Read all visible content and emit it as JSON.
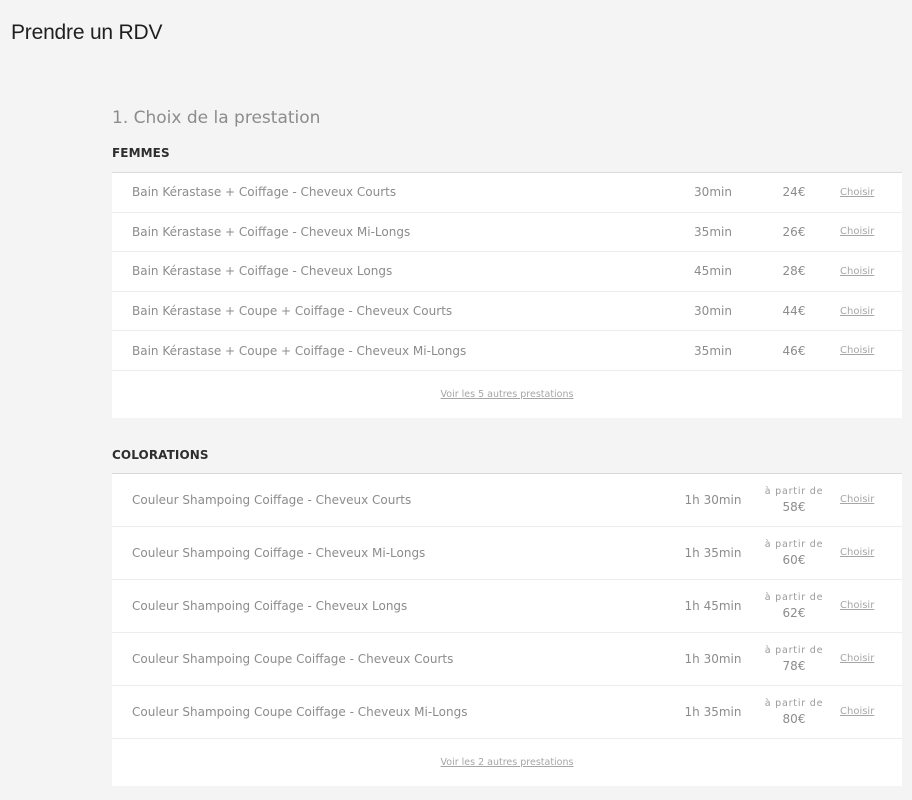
{
  "page": {
    "title": "Prendre un RDV"
  },
  "step": {
    "title": "1. Choix de la prestation"
  },
  "categories": [
    {
      "name": "FEMMES",
      "services": [
        {
          "name": "Bain Kérastase + Coiffage - Cheveux Courts",
          "duration": "30min",
          "price": "24€",
          "action": "Choisir"
        },
        {
          "name": "Bain Kérastase + Coiffage - Cheveux Mi-Longs",
          "duration": "35min",
          "price": "26€",
          "action": "Choisir"
        },
        {
          "name": "Bain Kérastase + Coiffage - Cheveux Longs",
          "duration": "45min",
          "price": "28€",
          "action": "Choisir"
        },
        {
          "name": "Bain Kérastase + Coupe + Coiffage - Cheveux Courts",
          "duration": "30min",
          "price": "44€",
          "action": "Choisir"
        },
        {
          "name": "Bain Kérastase + Coupe + Coiffage - Cheveux Mi-Longs",
          "duration": "35min",
          "price": "46€",
          "action": "Choisir"
        }
      ],
      "more_label": "Voir les 5 autres prestations"
    },
    {
      "name": "COLORATIONS",
      "services": [
        {
          "name": "Couleur Shampoing Coiffage - Cheveux Courts",
          "duration": "1h 30min",
          "price_prefix": "à partir de",
          "price": "58€",
          "action": "Choisir"
        },
        {
          "name": "Couleur Shampoing Coiffage - Cheveux Mi-Longs",
          "duration": "1h 35min",
          "price_prefix": "à partir de",
          "price": "60€",
          "action": "Choisir"
        },
        {
          "name": "Couleur Shampoing Coiffage - Cheveux Longs",
          "duration": "1h 45min",
          "price_prefix": "à partir de",
          "price": "62€",
          "action": "Choisir"
        },
        {
          "name": "Couleur Shampoing Coupe Coiffage - Cheveux Courts",
          "duration": "1h 30min",
          "price_prefix": "à partir de",
          "price": "78€",
          "action": "Choisir"
        },
        {
          "name": "Couleur Shampoing Coupe Coiffage - Cheveux Mi-Longs",
          "duration": "1h 35min",
          "price_prefix": "à partir de",
          "price": "80€",
          "action": "Choisir"
        }
      ],
      "more_label": "Voir les 2 autres prestations"
    }
  ],
  "colors": {
    "background": "#f4f4f4",
    "card": "#ffffff",
    "heading": "#2e2e2e",
    "text": "#8c8c8c"
  }
}
